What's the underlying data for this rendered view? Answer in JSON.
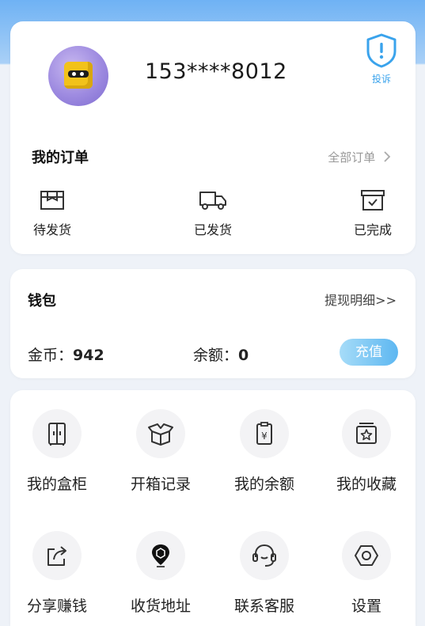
{
  "profile": {
    "phone": "153****8012",
    "report_label": "投诉"
  },
  "orders": {
    "title": "我的订单",
    "all_label": "全部订单",
    "items": [
      {
        "label": "待发货",
        "icon": "box-icon"
      },
      {
        "label": "已发货",
        "icon": "truck-icon"
      },
      {
        "label": "已完成",
        "icon": "archive-check-icon"
      }
    ]
  },
  "wallet": {
    "title": "钱包",
    "withdraw_label": "提现明细>>",
    "coins_label": "金币：",
    "coins_value": "942",
    "balance_label": "余额：",
    "balance_value": "0",
    "recharge_label": "充值"
  },
  "menu": {
    "items": [
      {
        "label": "我的盒柜",
        "icon": "cabinet-icon"
      },
      {
        "label": "开箱记录",
        "icon": "open-box-icon"
      },
      {
        "label": "我的余额",
        "icon": "yen-clipboard-icon"
      },
      {
        "label": "我的收藏",
        "icon": "star-box-icon"
      },
      {
        "label": "分享赚钱",
        "icon": "share-icon"
      },
      {
        "label": "收货地址",
        "icon": "location-pin-icon"
      },
      {
        "label": "联系客服",
        "icon": "headset-icon"
      },
      {
        "label": "设置",
        "icon": "settings-hexagon-icon"
      }
    ]
  },
  "colors": {
    "accent_blue": "#3aa3ec",
    "header_gradient_top": "#6fb2f4",
    "page_bg": "#eef2f8"
  }
}
